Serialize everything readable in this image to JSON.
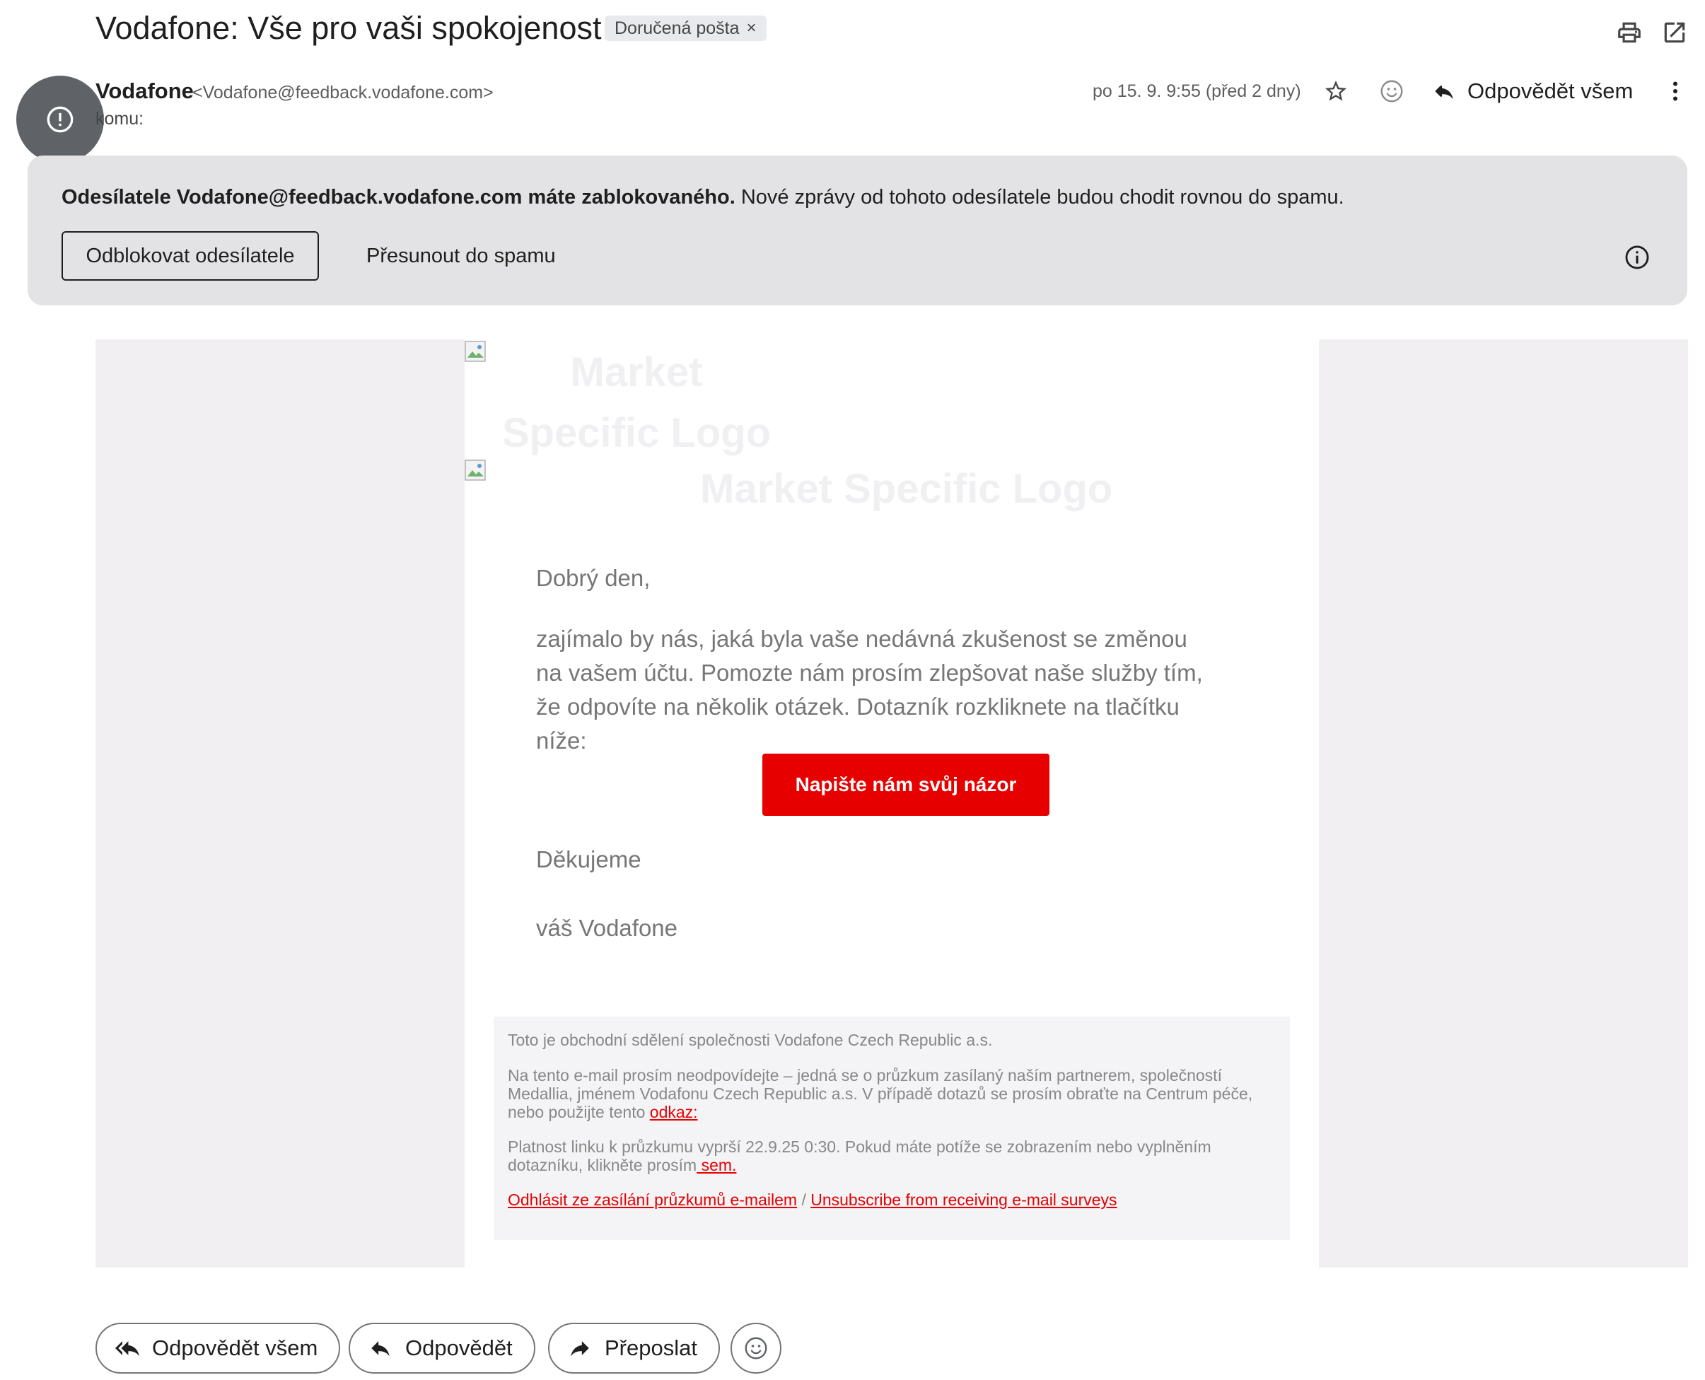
{
  "header": {
    "subject": "Vodafone: Vše pro vaši spokojenost",
    "label_chip": "Doručená pošta",
    "label_chip_close": "×"
  },
  "message": {
    "sender_name": "Vodafone",
    "sender_email": "<Vodafone@feedback.vodafone.com>",
    "to_label": "komu:",
    "date": "po 15. 9. 9:55 (před 2 dny)",
    "reply_all_label": "Odpovědět všem"
  },
  "banner": {
    "bold_text": "Odesílatele Vodafone@feedback.vodafone.com máte zablokovaného.",
    "text": " Nové zprávy od tohoto odesílatele budou chodit rovnou do spamu.",
    "unblock_button": "Odblokovat odesílatele",
    "spam_button": "Přesunout do spamu"
  },
  "email": {
    "logo_alt_1": "Market Specific Logo",
    "logo_alt_2": "Market Specific Logo",
    "greeting": "Dobrý den,",
    "paragraph": "zajímalo by nás, jaká byla vaše nedávná zkušenost se změnou na vašem účtu. Pomozte nám prosím zlepšovat naše služby tím, že odpovíte na několik otázek. Dotazník rozkliknete na tlačítku níže:",
    "cta_button": "Napište nám svůj názor",
    "thanks": "Děkujeme",
    "signoff": "váš Vodafone",
    "brand_color": "#e60000",
    "footer": {
      "line1": "Toto je obchodní sdělení společnosti Vodafone Czech Republic a.s.",
      "line2_text": "Na tento e-mail prosím neodpovídejte – jedná se o průzkum zasílaný naším partnerem, společností Medallia, jménem Vodafonu Czech Republic a.s. V případě dotazů se prosím obraťte na Centrum péče, nebo použijte tento ",
      "line2_link": "odkaz:",
      "line3_text": "Platnost linku k průzkumu vyprší 22.9.25 0:30. Pokud máte potíže se zobrazením nebo vyplněním dotazníku, klikněte prosím",
      "line3_link": " sem.",
      "unsubscribe_cz": "Odhlásit ze zasílání průzkumů e-mailem",
      "unsubscribe_sep": " / ",
      "unsubscribe_en": " Unsubscribe from receiving e-mail surveys"
    }
  },
  "actions": {
    "reply_all": "Odpovědět všem",
    "reply": "Odpovědět",
    "forward": "Přeposlat"
  },
  "icons": {
    "print": "print-icon",
    "open_new_window": "open-in-new-window-icon",
    "avatar": "warning-avatar-icon",
    "star": "star-icon",
    "emoji": "emoji-icon",
    "reply": "reply-icon",
    "more": "more-vertical-icon",
    "info": "info-icon",
    "reply_all": "reply-all-icon",
    "forward": "forward-icon",
    "broken_image": "broken-image-icon"
  }
}
